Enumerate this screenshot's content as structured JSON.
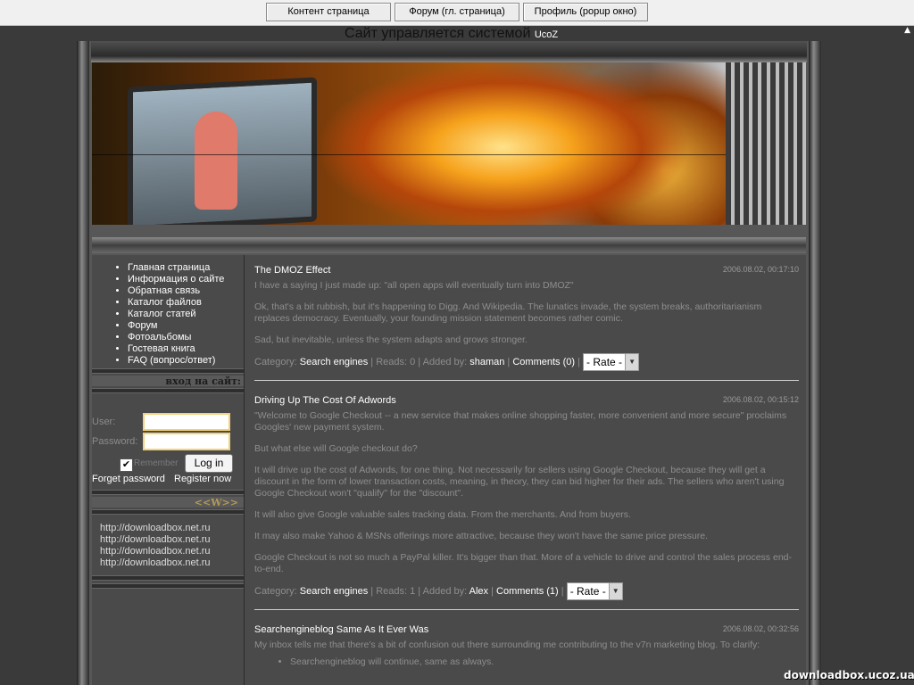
{
  "topbar": {
    "buttons": [
      "Контент страница",
      "Форум (гл. страница)",
      "Профиль (popup окно)"
    ]
  },
  "credit": {
    "text": "Сайт управляется системой",
    "brand": "UcoZ"
  },
  "sidebar": {
    "nav": [
      "Главная страница",
      "Информация о сайте",
      "Обратная связь",
      "Каталог файлов",
      "Каталог статей",
      "Форум",
      "Фотоальбомы",
      "Гостевая книга",
      "FAQ (вопрос/ответ)"
    ],
    "login_title": "вход на сайт:",
    "user_label": "User:",
    "password_label": "Password:",
    "remember_label": "Remember",
    "remember_checked": true,
    "login_button": "Log in",
    "forgot": "Forget password",
    "register": "Register now",
    "w_title": "<<W>>",
    "links": [
      "http://downloadbox.net.ru",
      "http://downloadbox.net.ru",
      "http://downloadbox.net.ru",
      "http://downloadbox.net.ru"
    ]
  },
  "posts": [
    {
      "title": "The DMOZ Effect",
      "date": "2006.08.02, 00:17:10",
      "paras": [
        "I have a saying I just made up: \"all open apps will eventually turn into DMOZ\"",
        "Ok, that's a bit rubbish, but it's happening to Digg. And Wikipedia. The lunatics invade, the system breaks, authoritarianism replaces democracy. Eventually, your founding mission statement becomes rather comic.",
        "Sad, but inevitable, unless the system adapts and grows stronger."
      ],
      "category": "Search engines",
      "reads": "0",
      "added_by": "shaman",
      "comments": "Comments (0)",
      "rate": "- Rate -"
    },
    {
      "title": "Driving Up The Cost Of Adwords",
      "date": "2006.08.02, 00:15:12",
      "paras": [
        "\"Welcome to Google Checkout -- a new service that makes online shopping faster, more convenient and more secure\" proclaims Googles' new payment system.",
        "But what else will Google checkout do?",
        "It will drive up the cost of Adwords, for one thing. Not necessarily for sellers using Google Checkout, because they will get a discount in the form of lower transaction costs, meaning, in theory, they can bid higher for their ads. The sellers who aren't using Google Checkout won't \"qualify\" for the \"discount\".",
        "It will also give Google valuable sales tracking data. From the merchants. And from buyers.",
        "It may also make Yahoo & MSNs offerings more attractive, because they won't have the same price pressure.",
        "Google Checkout is not so much a PayPal killer. It's bigger than that. More of a vehicle to drive and control the sales process end-to-end."
      ],
      "category": "Search engines",
      "reads": "1",
      "added_by": "Alex",
      "comments": "Comments (1)",
      "rate": "- Rate -"
    },
    {
      "title": "Searchengineblog Same As It Ever Was",
      "date": "2006.08.02, 00:32:56",
      "paras": [
        "My inbox tells me that there's a bit of confusion out there surrounding me contributing to the v7n marketing blog. To clarify:"
      ],
      "bullets": [
        "Searchengineblog will continue, same as always."
      ]
    }
  ],
  "labels": {
    "category": "Category:",
    "reads": "Reads:",
    "added_by": "Added by:"
  },
  "watermark": "downloadbox.ucoz.ua"
}
